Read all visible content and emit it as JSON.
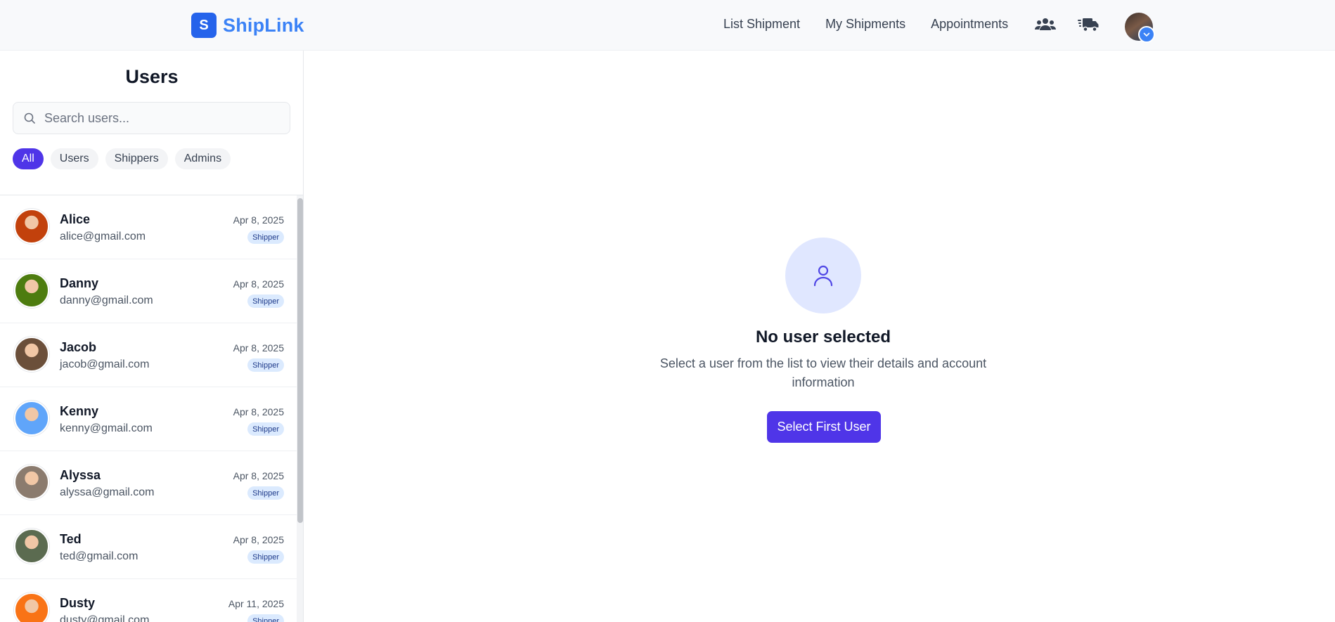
{
  "header": {
    "logo_letter": "S",
    "brand": "ShipLink",
    "nav": [
      "List Shipment",
      "My Shipments",
      "Appointments"
    ],
    "icons": [
      "users-icon",
      "truck-icon",
      "user-avatar",
      "chevron-down-icon"
    ]
  },
  "sidebar": {
    "title": "Users",
    "search_placeholder": "Search users...",
    "filters": [
      "All",
      "Users",
      "Shippers",
      "Admins"
    ],
    "active_filter": "All",
    "users": [
      {
        "name": "Alice",
        "email": "alice@gmail.com",
        "date": "Apr 8, 2025",
        "role": "Shipper",
        "avatar_color": "#c2410c"
      },
      {
        "name": "Danny",
        "email": "danny@gmail.com",
        "date": "Apr 8, 2025",
        "role": "Shipper",
        "avatar_color": "#4d7c0f"
      },
      {
        "name": "Jacob",
        "email": "jacob@gmail.com",
        "date": "Apr 8, 2025",
        "role": "Shipper",
        "avatar_color": "#6b4f3a"
      },
      {
        "name": "Kenny",
        "email": "kenny@gmail.com",
        "date": "Apr 8, 2025",
        "role": "Shipper",
        "avatar_color": "#60a5fa"
      },
      {
        "name": "Alyssa",
        "email": "alyssa@gmail.com",
        "date": "Apr 8, 2025",
        "role": "Shipper",
        "avatar_color": "#8b7b6e"
      },
      {
        "name": "Ted",
        "email": "ted@gmail.com",
        "date": "Apr 8, 2025",
        "role": "Shipper",
        "avatar_color": "#5b6b50"
      },
      {
        "name": "Dusty",
        "email": "dusty@gmail.com",
        "date": "Apr 11, 2025",
        "role": "Shipper",
        "avatar_color": "#f97316"
      }
    ]
  },
  "empty_state": {
    "icon": "user-icon",
    "title": "No user selected",
    "text": "Select a user from the list to view their details and account information",
    "button": "Select First User"
  },
  "colors": {
    "accent": "#4f35e8",
    "brand": "#3b82f6",
    "badge_bg": "#dbeafe"
  }
}
